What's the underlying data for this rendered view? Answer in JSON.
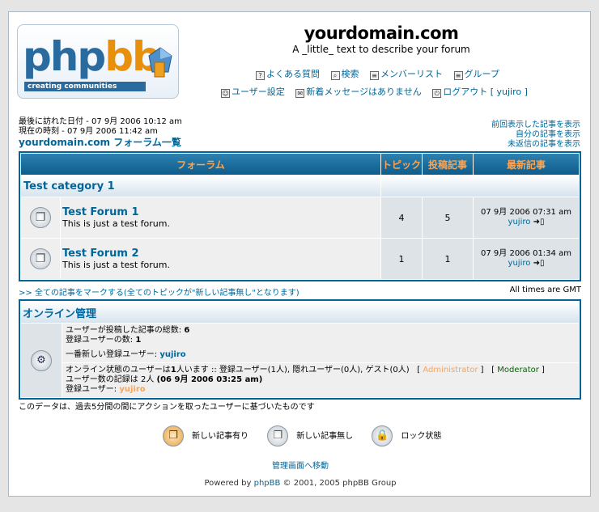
{
  "header": {
    "logo": {
      "php": "php",
      "bb": "bb",
      "tagline": "creating communities"
    },
    "site_title": "yourdomain.com",
    "site_desc": "A _little_ text to describe your forum",
    "nav_row1": [
      {
        "label": "よくある質問",
        "icon": "question-icon"
      },
      {
        "label": "検索",
        "icon": "search-icon"
      },
      {
        "label": "メンバーリスト",
        "icon": "memberlist-icon"
      },
      {
        "label": "グループ",
        "icon": "group-icon"
      }
    ],
    "nav_row2": [
      {
        "label": "ユーザー設定",
        "icon": "profile-icon"
      },
      {
        "label": "新着メッセージはありません",
        "icon": "message-icon"
      },
      {
        "label": "ログアウト [ yujiro ]",
        "icon": "logout-icon"
      }
    ]
  },
  "info": {
    "last_visit": "最後に訪れた日付 - 07 9月 2006 10:12 am",
    "current_time": "現在の時刻 - 07 9月 2006 11:42 am",
    "index_link": "yourdomain.com フォーラム一覧"
  },
  "right_links": [
    "前回表示した記事を表示",
    "自分の記事を表示",
    "未返信の記事を表示"
  ],
  "forum_table": {
    "headers": {
      "forum": "フォーラム",
      "topics": "トピック",
      "posts": "投稿記事",
      "last_post": "最新記事"
    },
    "category": "Test category 1",
    "forums": [
      {
        "name": "Test Forum 1",
        "desc": "This is just a test forum.",
        "topics": "4",
        "posts": "5",
        "last_date": "07 9月 2006 07:31 am",
        "last_user": "yujiro"
      },
      {
        "name": "Test Forum 2",
        "desc": "This is just a test forum.",
        "topics": "1",
        "posts": "1",
        "last_date": "07 9月 2006 01:34 am",
        "last_user": "yujiro"
      }
    ]
  },
  "below_table": {
    "mark_read": ">> 全ての記事をマークする(全てのトピックが\"新しい記事無し\"となります)",
    "timezone": "All times are GMT"
  },
  "online": {
    "title": "オンライン管理",
    "stats": {
      "total_posts_label": "ユーザーが投稿した記事の総数: ",
      "total_posts": "6",
      "total_users_label": "登録ユーザーの数: ",
      "total_users": "1",
      "newest_label": "一番新しい登録ユーザー: ",
      "newest_user": "yujiro"
    },
    "status": {
      "line1_prefix": "オンライン状態のユーザーは",
      "line1_count": "1",
      "line1_rest": "人います :: 登録ユーザー(1人), 隠れユーザー(0人), ゲスト(0人)   [",
      "admin": "Administrator",
      "mid": "]   [",
      "mod": "Moderator",
      "end": "]",
      "record_prefix": "ユーザー数の記録は 2人 ",
      "record_bold": "(06 9月 2006 03:25 am)",
      "registered_label": "登録ユーザー: ",
      "registered_user": "yujiro"
    }
  },
  "data_note": "このデータは、過去5分間の間にアクションを取ったユーザーに基づいたものです",
  "legend": [
    "新しい記事有り",
    "新しい記事無し",
    "ロック状態"
  ],
  "admin_link": "管理画面へ移動",
  "footer": {
    "prefix": "Powered by ",
    "brand": "phpBB",
    "suffix": " © 2001, 2005 phpBB Group"
  }
}
